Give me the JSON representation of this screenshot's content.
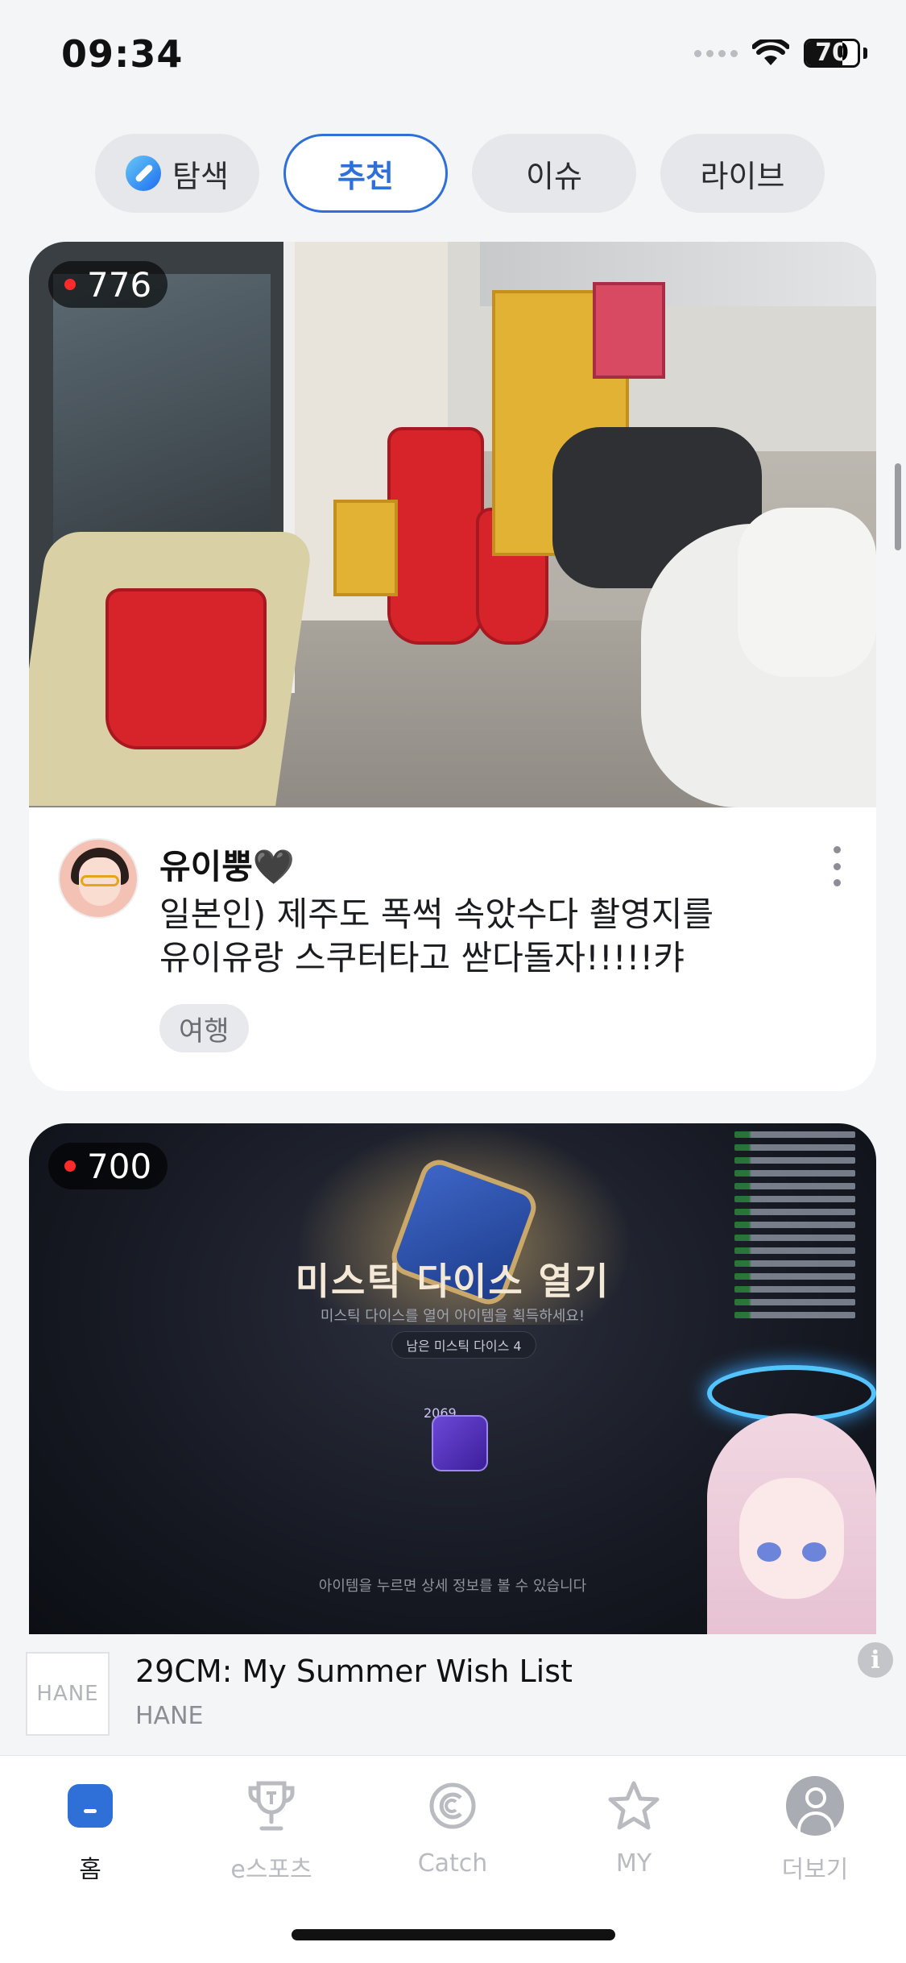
{
  "status_bar": {
    "time": "09:34",
    "battery": "70"
  },
  "tabs": [
    {
      "label": "탐색",
      "icon": "compass-icon",
      "active": false
    },
    {
      "label": "추천",
      "active": true
    },
    {
      "label": "이슈",
      "active": false
    },
    {
      "label": "라이브",
      "active": false
    }
  ],
  "streams": [
    {
      "viewers": "776",
      "streamer": "유이뿡🖤",
      "title_line1": "일본인) 제주도 폭썩 속았수다 촬영지를",
      "title_line2": "유이유랑 스쿠터타고 싿다돌자!!!!!캬",
      "tag": "여행"
    },
    {
      "viewers": "700",
      "game_title": "미스틱 다이스 열기",
      "game_subtitle": "미스틱 다이스를 열어 아이템을 획득하세요!",
      "game_pill": "남은 미스틱 다이스 4",
      "item_count": "2069",
      "game_hint": "아이템을 누르면 상세 정보를 볼 수 있습니다"
    }
  ],
  "ad": {
    "logo_text": "HANE",
    "title": "29CM: My Summer Wish List",
    "brand": "HANE"
  },
  "bottom_nav": [
    {
      "label": "홈",
      "icon": "home-icon",
      "active": true
    },
    {
      "label": "e스포츠",
      "icon": "trophy-icon",
      "active": false
    },
    {
      "label": "Catch",
      "icon": "catch-icon",
      "active": false
    },
    {
      "label": "MY",
      "icon": "star-icon",
      "active": false
    },
    {
      "label": "더보기",
      "icon": "profile-icon",
      "active": false
    }
  ],
  "colors": {
    "accent": "#2f6fd8",
    "live_dot": "#ff2a2a"
  }
}
